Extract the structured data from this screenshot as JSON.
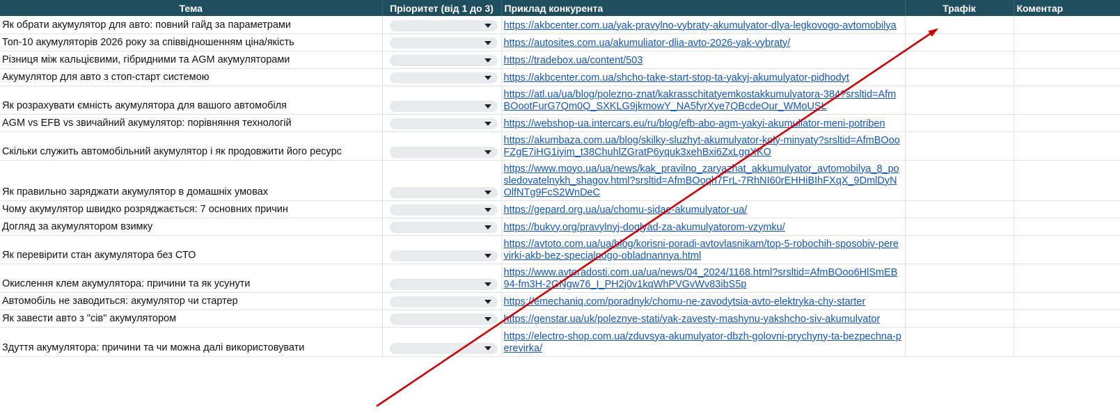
{
  "headers": {
    "topic": "Тема",
    "priority": "Пріоритет (від 1 до 3)",
    "competitor": "Приклад конкурента",
    "traffic": "Трафік",
    "comment": "Коментар"
  },
  "rows": [
    {
      "topic": "Як обрати акумулятор для авто: повний гайд за параметрами",
      "url": "https://akbcenter.com.ua/yak-pravylno-vybraty-akumulyator-dlya-legkovogo-avtomobilya"
    },
    {
      "topic": "Топ-10 акумуляторів 2026 року за співвідношенням ціна/якість",
      "url": "https://autosites.com.ua/akumuliator-dlia-avto-2026-yak-vybraty/"
    },
    {
      "topic": "Різниця між кальцієвими, гібридними та AGM акумуляторами",
      "url": "https://tradebox.ua/content/503"
    },
    {
      "topic": "Акумулятор для авто з стоп-старт системою",
      "url": "https://akbcenter.com.ua/shcho-take-start-stop-ta-yakyj-akumulyator-pidhodyt"
    },
    {
      "topic": "Як розрахувати ємність акумулятора для вашого автомобіля",
      "url": "https://atl.ua/ua/blog/polezno-znat/kakrasschitatyemkostakkumulyatora-384?srsltid=AfmBOootFurG7Qm0Q_SXKLG9jkmowY_NA5fyrXye7QBcdeOur_WMoUSL"
    },
    {
      "topic": "AGM vs EFB vs звичайний акумулятор: порівняння технологій",
      "url": "https://webshop-ua.intercars.eu/ru/blog/efb-abo-agm-yakyi-akumuliator-meni-potriben"
    },
    {
      "topic": "Скільки служить автомобільний акумулятор і як продовжити його ресурс",
      "url": "https://akumbaza.com.ua/blog/skilky-sluzhyt-akumulyator-koly-minyaty?srsltid=AfmBOooFZgE7iHG1iyim_t38ChuhlZGratP6yquk3xehBxi6ZxLgqXKO"
    },
    {
      "topic": "Як правильно заряджати акумулятор в домашніх умовах",
      "url": "https://www.moyo.ua/ua/news/kak_pravilno_zaryazhat_akkumulyator_avtomobilya_8_posledovatelnykh_shagov.html?srsltid=AfmBOoqh7FrL-7RhNI60rEHHiBIhFXqX_9DmlDyNOlfNTg9FcS2WnDeC"
    },
    {
      "topic": "Чому акумулятор швидко розряджається: 7 основних причин",
      "url": "https://gepard.org.ua/ua/chomu-sidae-akumulyator-ua/"
    },
    {
      "topic": "Догляд за акумулятором взимку",
      "url": "https://bukvy.org/pravylnyj-doglyad-za-akumulyatorom-vzymku/"
    },
    {
      "topic": "Як перевірити стан акумулятора без СТО",
      "url": "https://avtoto.com.ua/ua/blog/korisni-poradi-avtovlasnikam/top-5-robochih-sposobiv-perevirki-akb-bez-specialnogo-obladnannya.html"
    },
    {
      "topic": "Окислення клем акумулятора: причини та як усунути",
      "url": "https://www.avtoradosti.com.ua/ua/news/04_2024/1168.html?srsltid=AfmBOoo6HlSmEB94-fm3H-2GNgw76_I_PH2j0v1kqWhPVGvWv83ibS5p"
    },
    {
      "topic": "Автомобіль не заводиться: акумулятор чи стартер",
      "url": "https://emechaniq.com/poradnyk/chomu-ne-zavodytsia-avto-elektryka-chy-starter"
    },
    {
      "topic": "Як завести авто з \"сів\" акумулятором",
      "url": "https://genstar.ua/uk/poleznye-stati/yak-zavesty-mashynu-yakshcho-siv-akumulyator"
    },
    {
      "topic": "Здуття акумулятора: причини та чи можна далі використовувати",
      "url": "https://electro-shop.com.ua/zduvsya-akumulyator-dbzh-golovni-prychyny-ta-bezpechna-perevirka/"
    }
  ],
  "colors": {
    "header_bg": "#1f4e5f",
    "link": "#1155cc",
    "arrow": "#d40000"
  }
}
